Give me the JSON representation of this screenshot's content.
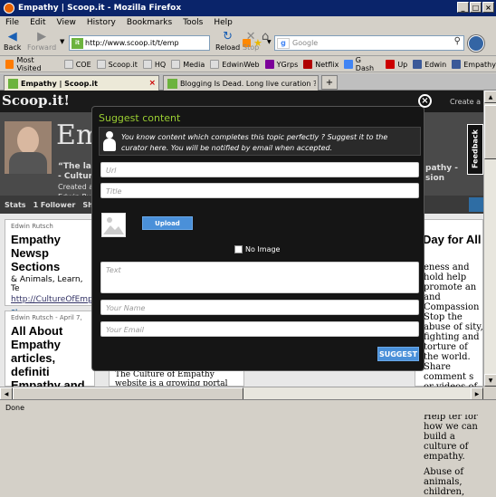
{
  "window": {
    "title": "Empathy | Scoop.it - Mozilla Firefox"
  },
  "menu": [
    "File",
    "Edit",
    "View",
    "History",
    "Bookmarks",
    "Tools",
    "Help"
  ],
  "nav": {
    "back": "Back",
    "forward": "Forward",
    "reload": "Reload",
    "stop": "Stop",
    "home": "Home"
  },
  "url": "http://www.scoop.it/t/emp",
  "search": {
    "placeholder": "Google"
  },
  "bookmarks": [
    {
      "label": "Most Visited",
      "color": "#ff7b00"
    },
    {
      "label": "COE",
      "color": "#dddddd"
    },
    {
      "label": "Scoop.it",
      "color": "#dddddd"
    },
    {
      "label": "HQ",
      "color": "#dddddd"
    },
    {
      "label": "Media",
      "color": "#dddddd"
    },
    {
      "label": "EdwinWeb",
      "color": "#dddddd"
    },
    {
      "label": "YGrps",
      "color": "#7b0099"
    },
    {
      "label": "Netflix",
      "color": "#b00000"
    },
    {
      "label": "G Dash",
      "color": "#4285f4"
    },
    {
      "label": "Up",
      "color": "#cc0000"
    },
    {
      "label": "Edwin",
      "color": "#3b5998"
    },
    {
      "label": "Empathy",
      "color": "#3b5998"
    }
  ],
  "tabs": [
    {
      "label": "Empathy | Scoop.it"
    },
    {
      "label": "Blogging Is Dead. Long live curation ?S..."
    }
  ],
  "page": {
    "logo": "Scoop.it!",
    "create": "Create a",
    "title": "Emp",
    "subtitle1": "“The lat",
    "subtitle2": "- CultureO",
    "created": "Created an",
    "author": "Edwin Rutsc",
    "right1": "pathy -",
    "right2": "sion",
    "stats": [
      "Stats",
      "1 Follower",
      "Shar"
    ],
    "feedback": "Feedback",
    "card1": {
      "user": "Edwin Rutsch",
      "title": "Empathy Newsp Sections",
      "body": "& Animals, Learn, Te",
      "link": "http://CultureOfEmp",
      "share": "Share"
    },
    "card2": {
      "user": "Edwin Rutsch - April 7,",
      "title": "All About Empathy articles, definiti Empathy and Co"
    },
    "rightcard": {
      "title": "Day for All",
      "body": "eness and hold help promote an and Compassion Stop the abuse of sity, fighting and torture of the world. Share comment s or videos of pathy and animals. Help ter for how we can build a culture of empathy.",
      "abuse": "Abuse of animals, children,"
    },
    "bottomtext": "The Culture of Empathy website is a growing portal for resources"
  },
  "modal": {
    "title": "Suggest content",
    "note": "You know content which completes this topic perfectly ? Suggest it to the curator here. You will be notified by email when accepted.",
    "url_placeholder": "Url",
    "title_placeholder": "Title",
    "upload": "Upload",
    "noimage": "No Image",
    "text_placeholder": "Text",
    "name_placeholder": "Your Name",
    "email_placeholder": "Your Email",
    "suggest": "SUGGEST"
  },
  "status": "Done"
}
